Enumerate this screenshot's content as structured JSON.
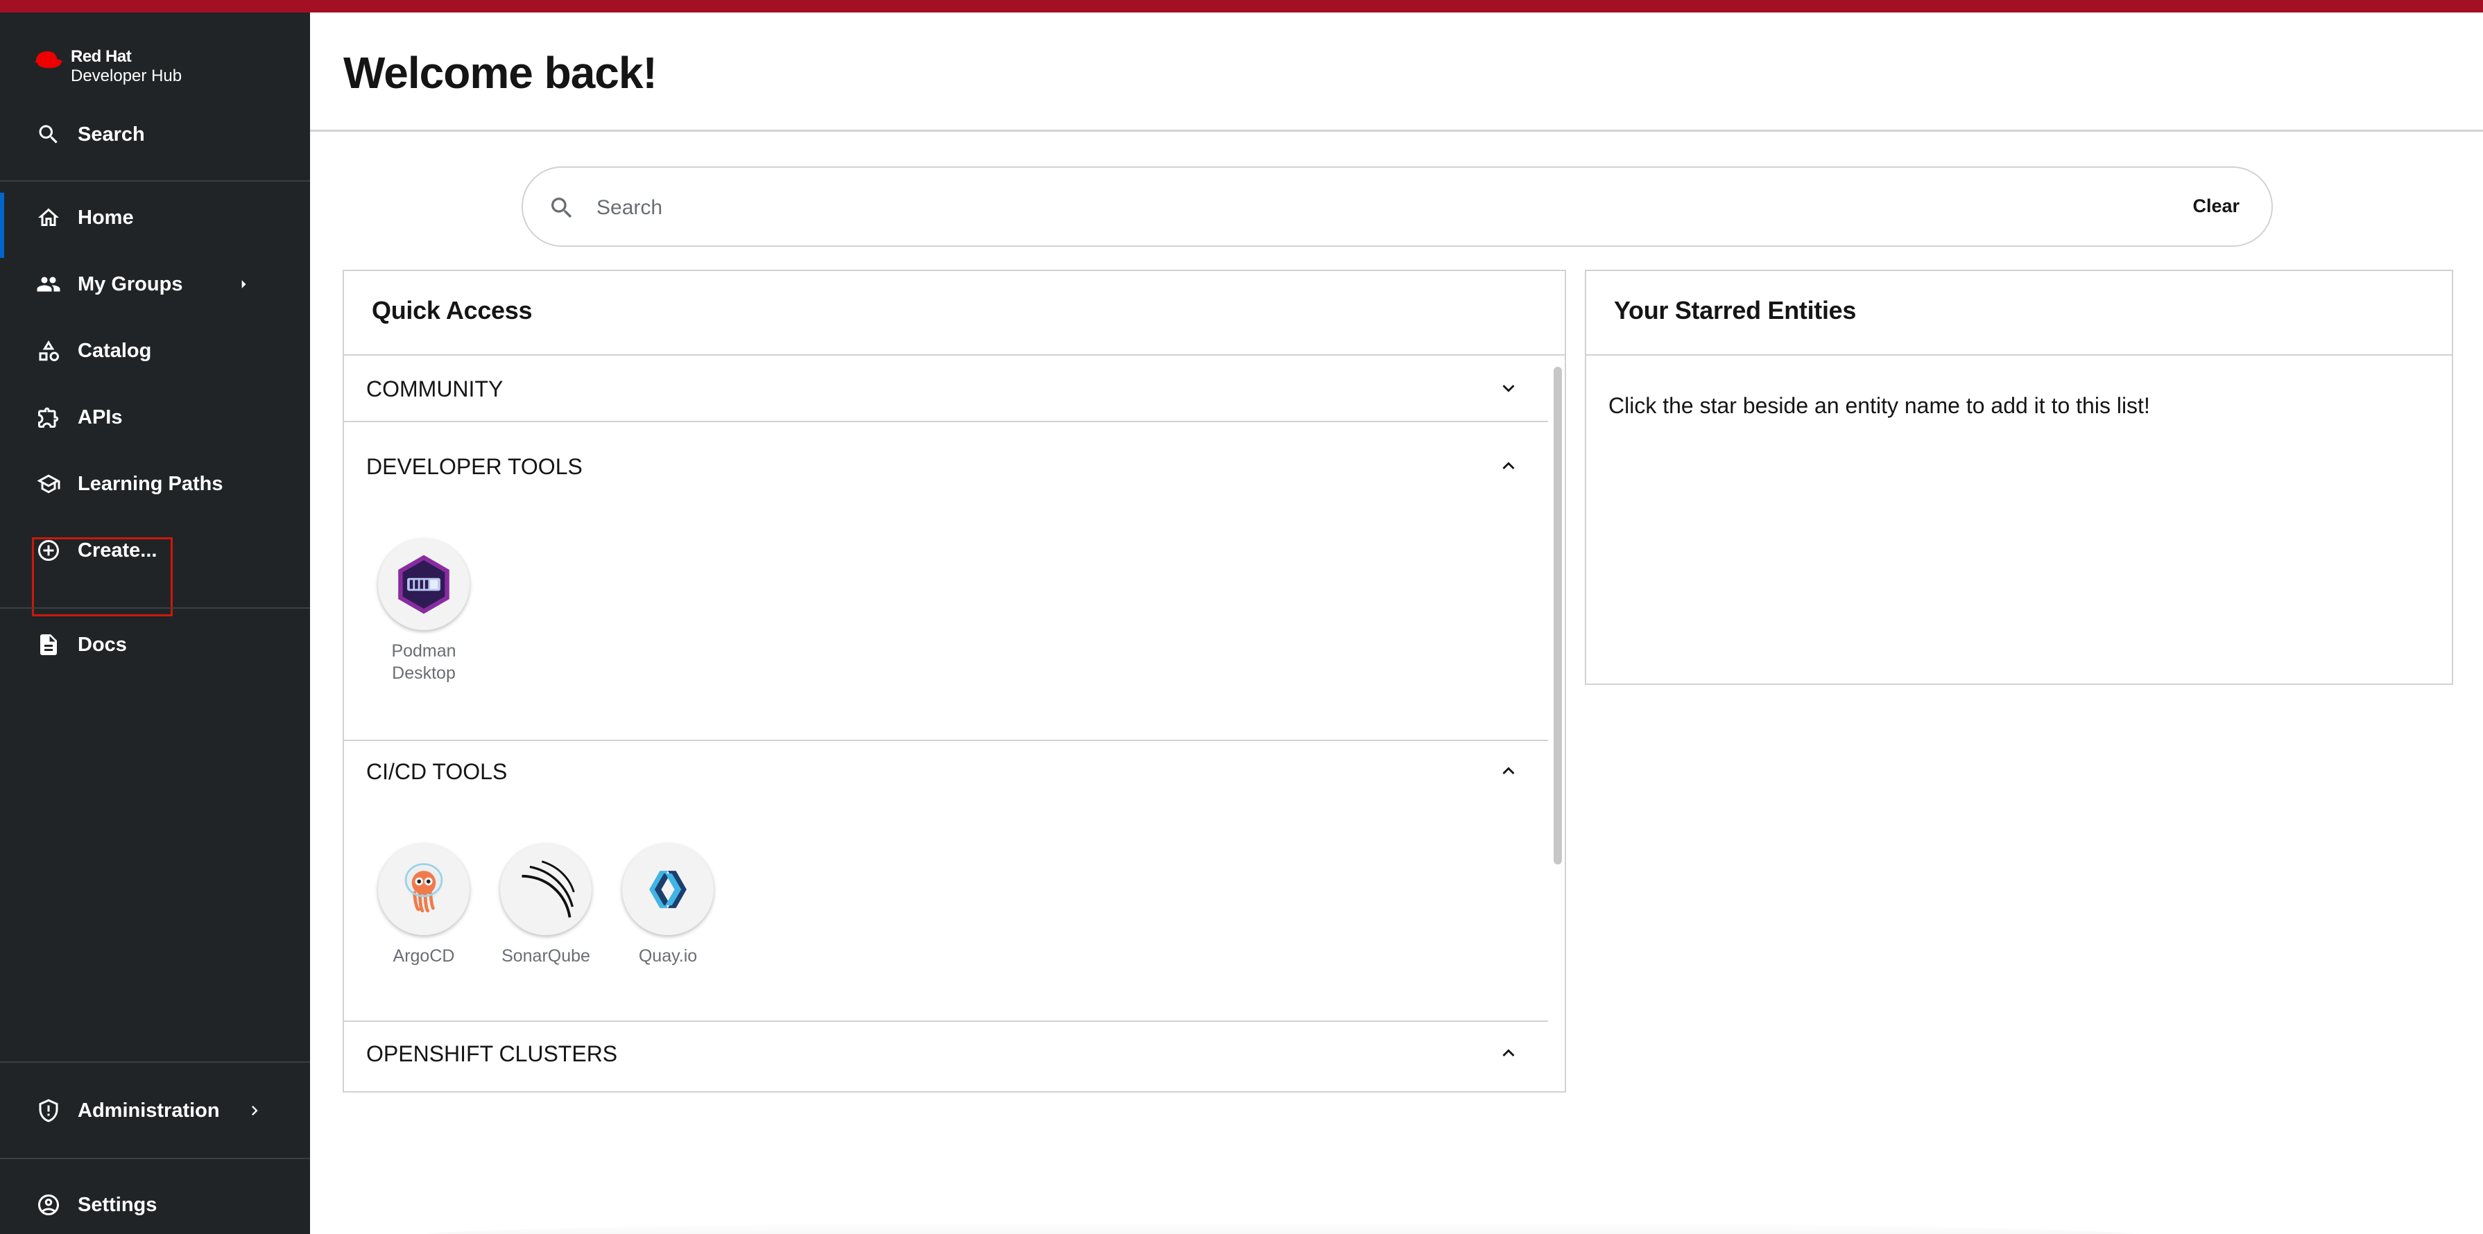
{
  "brand": {
    "line1": "Red Hat",
    "line2": "Developer Hub",
    "accent_color": "#a30f23"
  },
  "sidebar": {
    "search_label": "Search",
    "items": [
      {
        "label": "Home",
        "icon": "home-icon",
        "active": true
      },
      {
        "label": "My Groups",
        "icon": "groups-icon",
        "has_caret": true
      },
      {
        "label": "Catalog",
        "icon": "catalog-icon"
      },
      {
        "label": "APIs",
        "icon": "puzzle-icon"
      },
      {
        "label": "Learning Paths",
        "icon": "school-icon"
      },
      {
        "label": "Create...",
        "icon": "add-circle-icon",
        "highlighted": true
      },
      {
        "label": "Docs",
        "icon": "document-icon"
      }
    ],
    "admin_label": "Administration",
    "settings_label": "Settings"
  },
  "header": {
    "title": "Welcome back!"
  },
  "search": {
    "placeholder": "Search",
    "value": "",
    "clear_label": "Clear"
  },
  "quick_access": {
    "title": "Quick Access",
    "sections": [
      {
        "title": "COMMUNITY",
        "expanded": false,
        "tools": []
      },
      {
        "title": "DEVELOPER TOOLS",
        "expanded": true,
        "tools": [
          {
            "name_line1": "Podman",
            "name_line2": "Desktop",
            "icon": "podman-icon"
          }
        ]
      },
      {
        "title": "CI/CD TOOLS",
        "expanded": true,
        "tools": [
          {
            "name": "ArgoCD",
            "icon": "argocd-icon"
          },
          {
            "name": "SonarQube",
            "icon": "sonarqube-icon"
          },
          {
            "name": "Quay.io",
            "icon": "quay-icon"
          }
        ]
      },
      {
        "title": "OPENSHIFT CLUSTERS",
        "expanded": true,
        "tools": []
      }
    ]
  },
  "starred": {
    "title": "Your Starred Entities",
    "empty_message": "Click the star beside an entity name to add it to this list!"
  }
}
